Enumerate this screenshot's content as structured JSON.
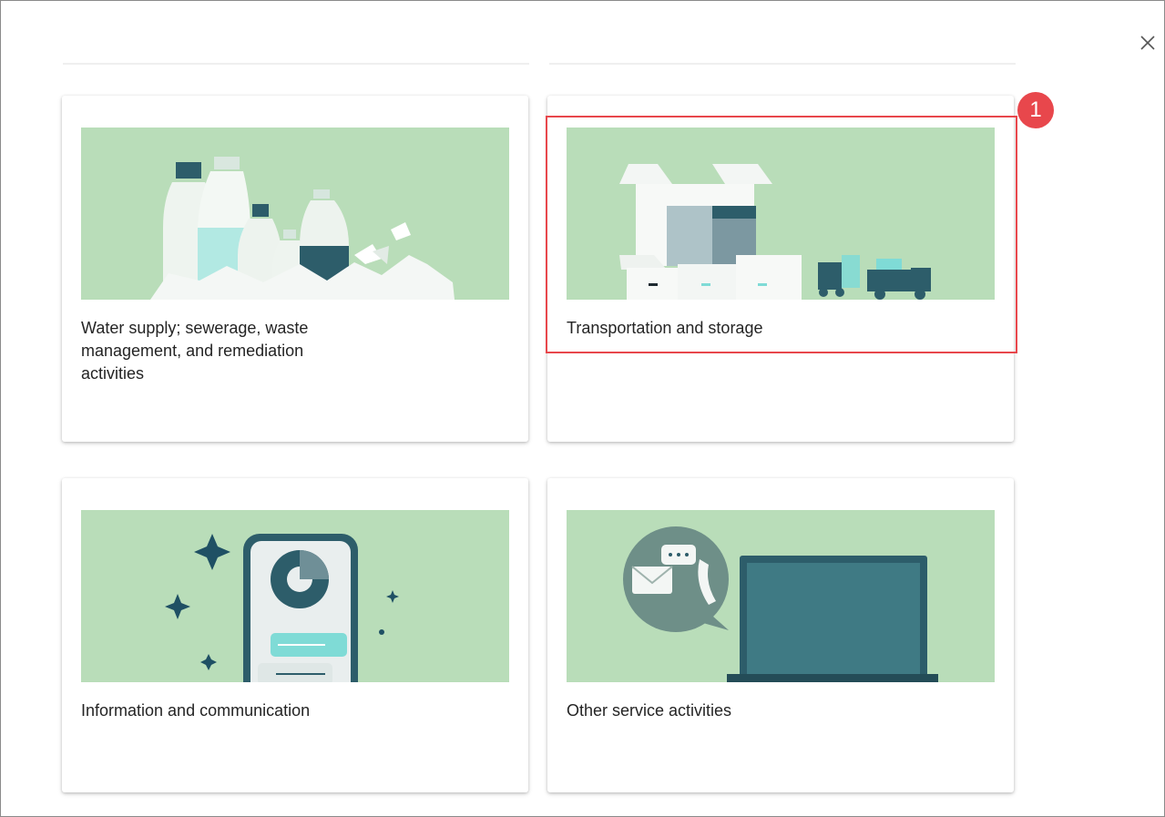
{
  "dialog": {
    "close_icon": "close-icon"
  },
  "cards": [
    {
      "title": "Water supply; sewerage, waste management, and remediation activities",
      "illustration": "plastic-bottles-illustration"
    },
    {
      "title": "Transportation and storage",
      "illustration": "boxes-and-truck-illustration"
    },
    {
      "title": "Information and communication",
      "illustration": "smartphone-illustration"
    },
    {
      "title": "Other service activities",
      "illustration": "laptop-and-messages-illustration"
    }
  ],
  "annotation": {
    "badge_number": "1",
    "color": "#e8474c"
  },
  "colors": {
    "illustration_bg": "#b9ddb9",
    "teal_dark": "#2d5d6a",
    "teal_light": "#7fdbd6"
  }
}
